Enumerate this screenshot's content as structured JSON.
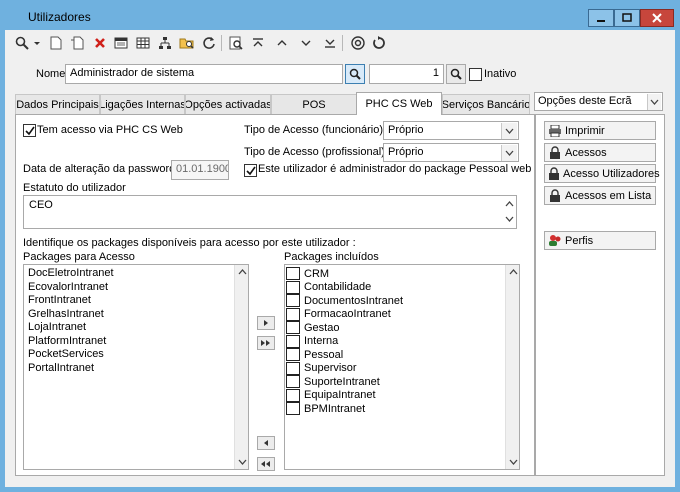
{
  "window": {
    "title": "Utilizadores",
    "buttons": {
      "minimize": "minimize-icon",
      "maximize": "maximize-icon",
      "close": "close-icon"
    }
  },
  "toolbar": {
    "icons": [
      "search-icon",
      "dropdown-arrow-icon",
      "new-document-icon",
      "copy-document-icon",
      "delete-icon",
      "window-icon",
      "grid-icon",
      "tree-icon",
      "folder-search-icon",
      "refresh-icon",
      "preview-icon",
      "first-icon",
      "previous-icon",
      "next-icon",
      "last-icon",
      "web-icon",
      "reload-icon"
    ]
  },
  "header": {
    "name_label": "Nome",
    "name_value": "Administrador de sistema",
    "number_value": "1",
    "inactive_label": "Inativo",
    "inactive_checked": false
  },
  "tabs": [
    {
      "label": "Dados Principais",
      "active": false
    },
    {
      "label": "Ligações Internas",
      "active": false
    },
    {
      "label": "Opções activadas",
      "active": false
    },
    {
      "label": "POS",
      "active": false
    },
    {
      "label": "PHC CS Web",
      "active": true
    },
    {
      "label": "Serviços Bancário",
      "active": false
    }
  ],
  "web": {
    "access_label": "Tem acesso via PHC CS Web",
    "access_checked": true,
    "tipo_func_label": "Tipo de Acesso (funcionário)",
    "tipo_func_value": "Próprio",
    "tipo_prof_label": "Tipo de Acesso (profissional)",
    "tipo_prof_value": "Próprio",
    "password_date_label": "Data de alteração da password",
    "password_date_value": "01.01.1900",
    "admin_label": "Este utilizador é administrador do package Pessoal web",
    "admin_checked": true,
    "estatuto_label": "Estatuto do utilizador",
    "estatuto_value": "CEO",
    "identify_label": "Identifique os packages disponíveis para acesso por este utilizador :",
    "available_label": "Packages para Acesso",
    "included_label": "Packages incluídos",
    "available": [
      "DocEletroIntranet",
      "EcovalorIntranet",
      "FrontIntranet",
      "GrelhasIntranet",
      "LojaIntranet",
      "PlatformIntranet",
      "PocketServices",
      "PortalIntranet"
    ],
    "included": [
      "CRM",
      "Contabilidade",
      "DocumentosIntranet",
      "FormacaoIntranet",
      "Gestao",
      "Interna",
      "Pessoal",
      "Supervisor",
      "SuporteIntranet",
      "EquipaIntranet",
      "BPMIntranet"
    ]
  },
  "options": {
    "title": "Opções deste Ecrã",
    "buttons": [
      {
        "label": "Imprimir",
        "icon": "printer-icon"
      },
      {
        "label": "Acessos",
        "icon": "lock-icon"
      },
      {
        "label": "Acesso Utilizadores",
        "icon": "lock-icon"
      },
      {
        "label": "Acessos em Lista",
        "icon": "lock-icon"
      },
      {
        "label": "Perfis",
        "icon": "users-icon"
      }
    ]
  }
}
